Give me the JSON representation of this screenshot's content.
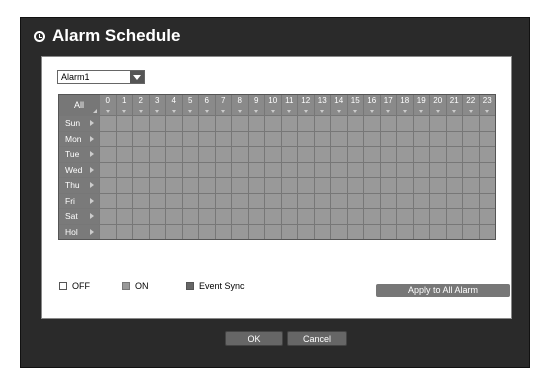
{
  "window": {
    "title": "Alarm Schedule",
    "icon": "clock-icon"
  },
  "selector": {
    "value": "Alarm1"
  },
  "grid": {
    "all_label": "All",
    "hours": [
      "0",
      "1",
      "2",
      "3",
      "4",
      "5",
      "6",
      "7",
      "8",
      "9",
      "10",
      "11",
      "12",
      "13",
      "14",
      "15",
      "16",
      "17",
      "18",
      "19",
      "20",
      "21",
      "22",
      "23"
    ],
    "days": [
      "Sun",
      "Mon",
      "Tue",
      "Wed",
      "Thu",
      "Fri",
      "Sat",
      "Hol"
    ]
  },
  "legend": {
    "off": "OFF",
    "on": "ON",
    "event_sync": "Event Sync"
  },
  "colors": {
    "off": "#ffffff",
    "on": "#999999",
    "event_sync": "#666666"
  },
  "buttons": {
    "apply_all": "Apply to All Alarm",
    "ok": "OK",
    "cancel": "Cancel"
  }
}
